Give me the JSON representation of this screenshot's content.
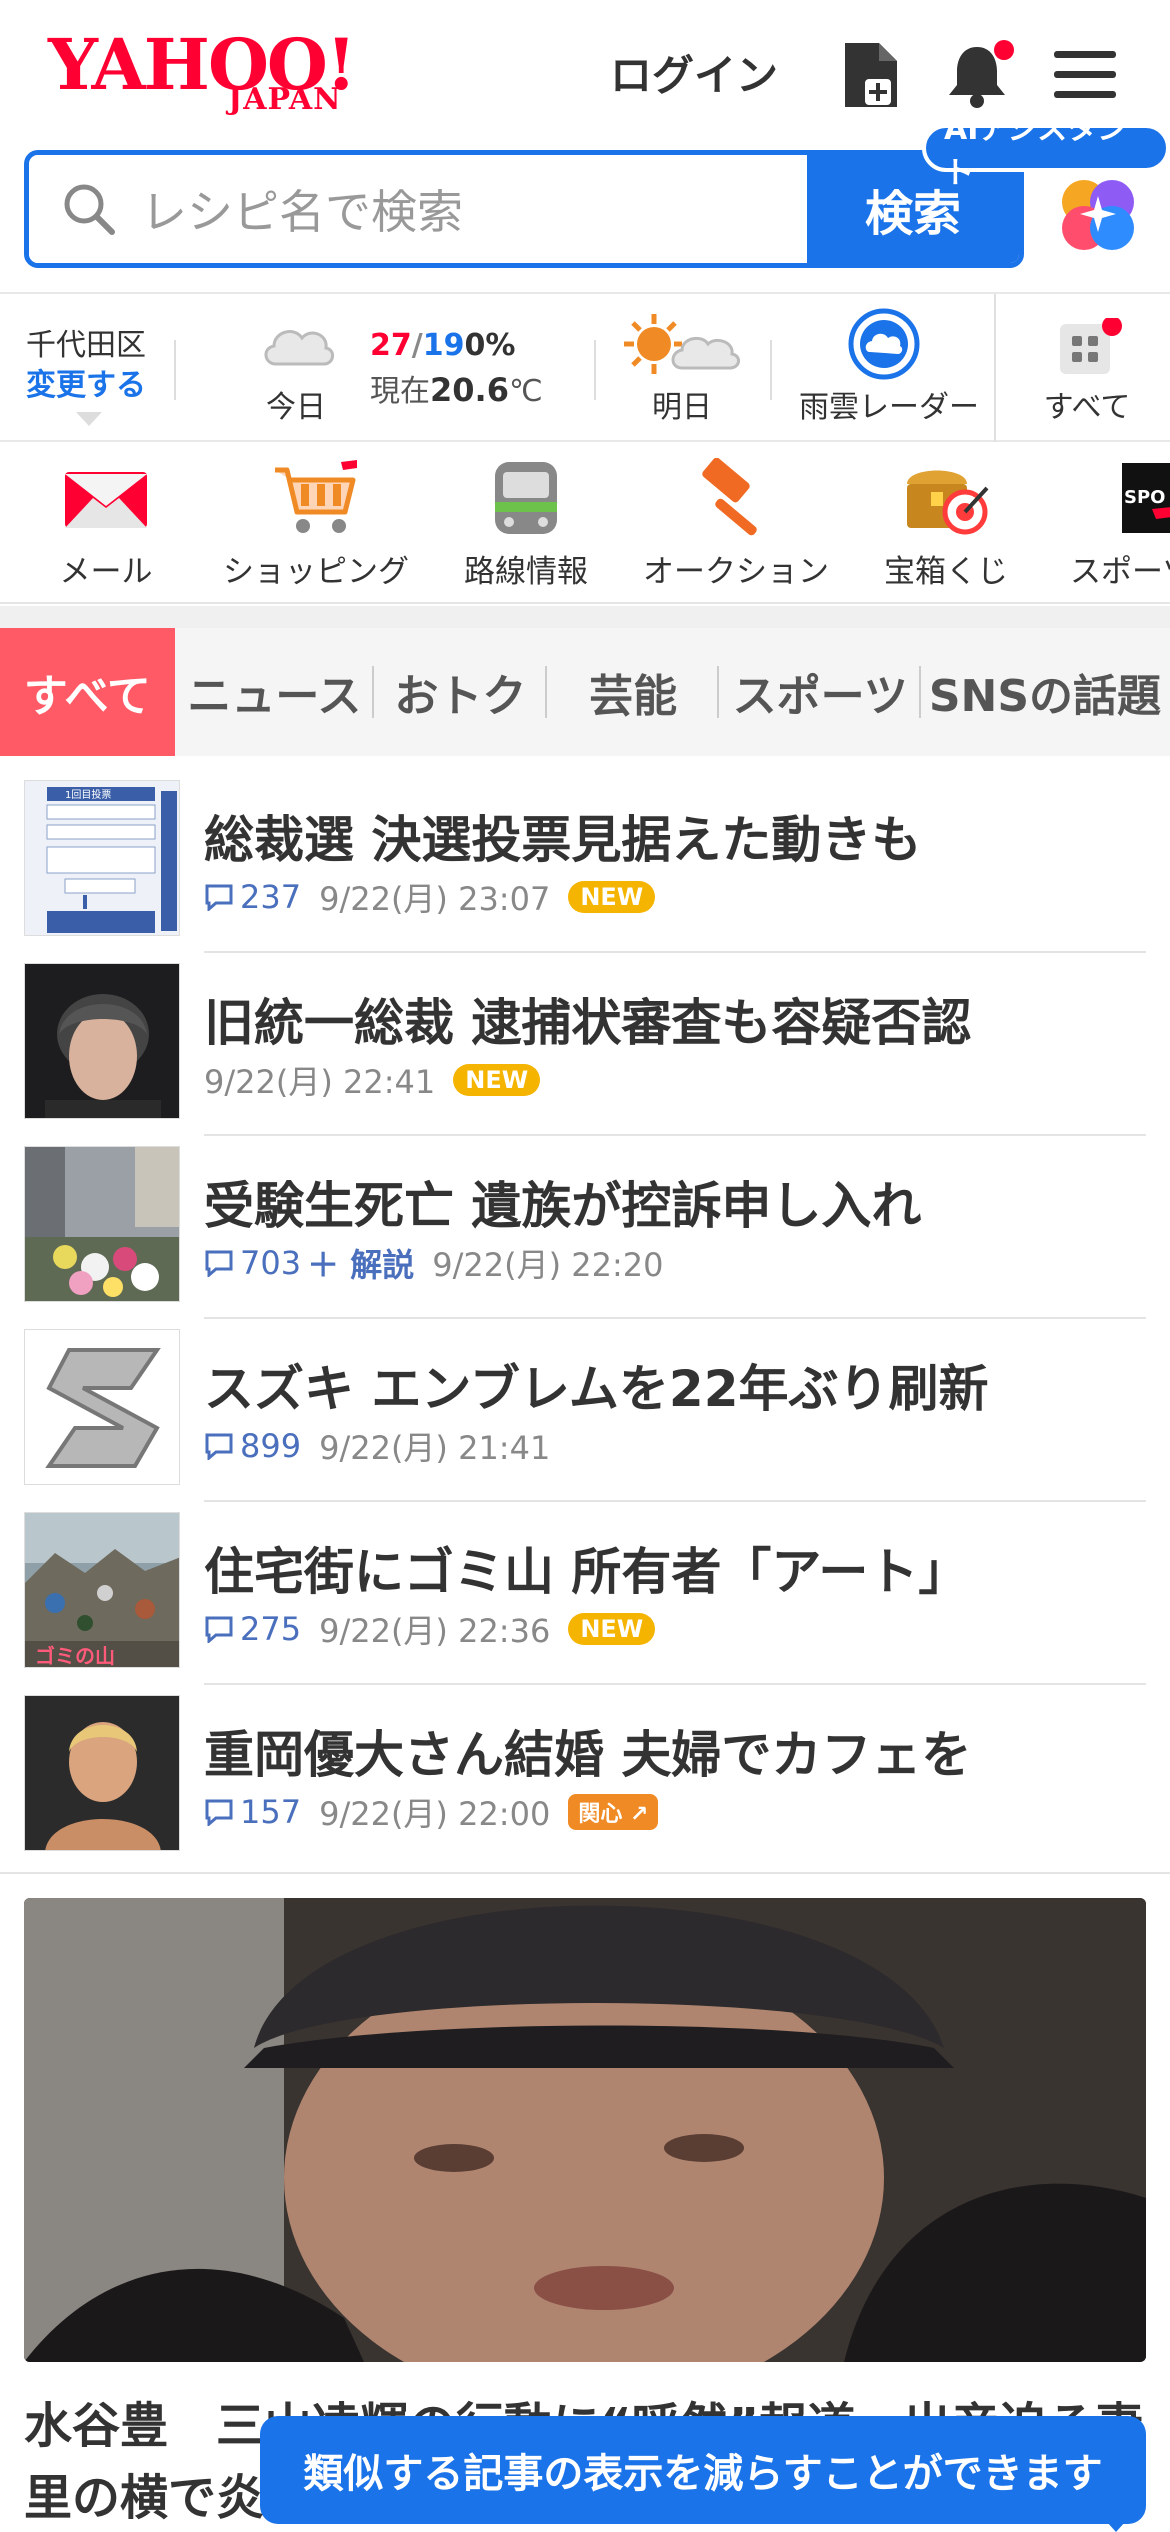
{
  "header": {
    "logo_main": "YAHOO!",
    "logo_sub": "JAPAN",
    "login_label": "ログイン",
    "icons": [
      "new-doc-icon",
      "bell-icon",
      "menu-icon"
    ]
  },
  "search": {
    "placeholder": "レシピ名で検索",
    "button_label": "検索",
    "ai_label": "AIアシスタント"
  },
  "weather": {
    "location": "千代田区",
    "change_label": "変更する",
    "today_label": "今日",
    "high": "27",
    "slash": "/",
    "low": "19",
    "rain": "0%",
    "now_prefix": "現在",
    "now_temp": "20.6",
    "now_unit": "℃",
    "tomorrow_label": "明日",
    "radar_label": "雨雲レーダー",
    "all_label": "すべて"
  },
  "services": [
    {
      "label": "メール",
      "icon": "mail-icon"
    },
    {
      "label": "ショッピング",
      "icon": "cart-icon"
    },
    {
      "label": "路線情報",
      "icon": "train-icon"
    },
    {
      "label": "オークション",
      "icon": "gavel-icon"
    },
    {
      "label": "宝箱くじ",
      "icon": "treasure-icon"
    },
    {
      "label": "スポーツ",
      "icon": "sports-icon"
    }
  ],
  "tabs": [
    "すべて",
    "ニュース",
    "おトク",
    "芸能",
    "スポーツ",
    "SNSの話題"
  ],
  "news": [
    {
      "title": "総裁選 決選投票見据えた動きも",
      "comments": "237",
      "time": "9/22(月) 23:07",
      "badge": "NEW"
    },
    {
      "title": "旧統一総裁 逮捕状審査も容疑否認",
      "comments": "",
      "time": "9/22(月) 22:41",
      "badge": "NEW"
    },
    {
      "title": "受験生死亡 遺族が控訴申し入れ",
      "comments": "703",
      "extra": "＋ 解説",
      "time": "9/22(月) 22:20",
      "badge": ""
    },
    {
      "title": "スズキ エンブレムを22年ぶり刷新",
      "comments": "899",
      "time": "9/22(月) 21:41",
      "badge": ""
    },
    {
      "title": "住宅街にゴミ山 所有者「アート」",
      "comments": "275",
      "time": "9/22(月) 22:36",
      "badge": "NEW"
    },
    {
      "title": "重岡優大さん結婚 夫婦でカフェを",
      "comments": "157",
      "time": "9/22(月) 22:00",
      "badge": "関心"
    }
  ],
  "thumb_text": {
    "item1_caption": "1回目投票",
    "item5_caption": "ゴミの山"
  },
  "feature": {
    "headline": "水谷豊　三山凌輝の行動に“呼然”報道　出産迫る妻里の横で炎"
  },
  "toast": "類似する記事の表示を減らすことができます",
  "colors": {
    "brand_red": "#ff0033",
    "accent_blue": "#1a73e8",
    "tab_active": "#ff5a66"
  }
}
